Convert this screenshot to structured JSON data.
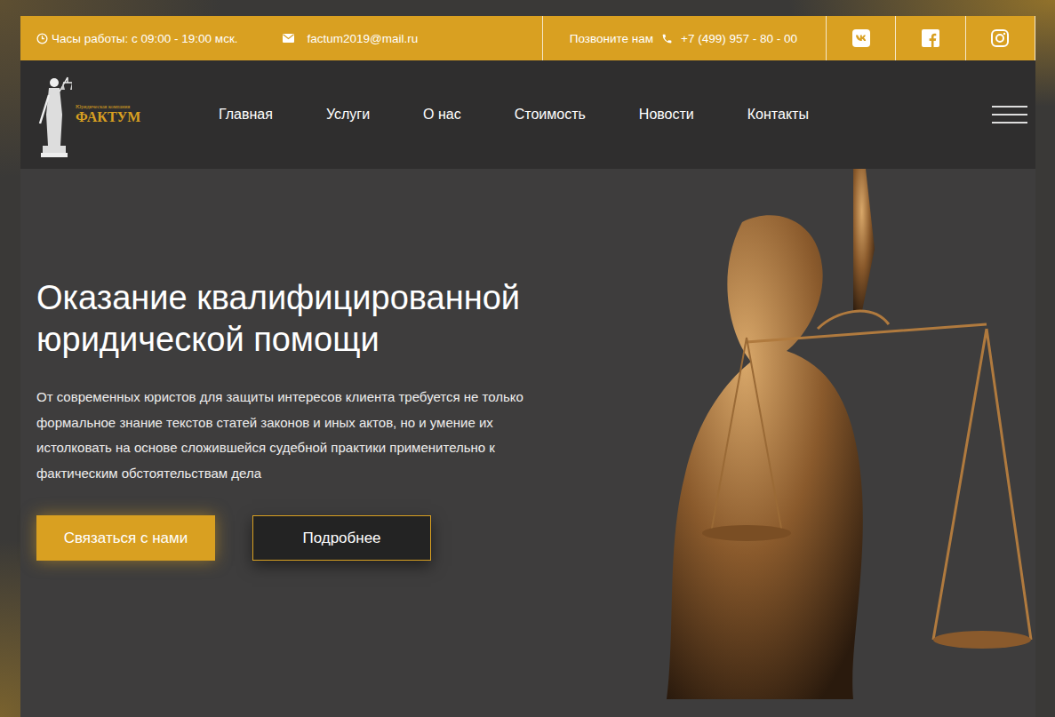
{
  "topbar": {
    "hours": "Часы работы: с 09:00 - 19:00 мск.",
    "email": "factum2019@mail.ru",
    "call_label": "Позвоните нам",
    "phone": "+7 (499) 957 - 80 - 00"
  },
  "logo": {
    "tagline": "Юридическая компания",
    "name": "ФАКТУМ"
  },
  "nav": [
    {
      "label": "Главная",
      "selected": false
    },
    {
      "label": "Услуги",
      "selected": false
    },
    {
      "label": "О нас",
      "selected": false
    },
    {
      "label": "Стоимость",
      "selected": false
    },
    {
      "label": "Новости",
      "selected": false
    },
    {
      "label": "Контакты",
      "selected": false
    }
  ],
  "hero": {
    "title": [
      "Оказание квалифицированной",
      "юридической помощи"
    ],
    "text": "От современных юристов для защиты интересов клиента требуется не только формальное знание текстов статей законов и иных актов, но и умение их истолковать на основе сложившейся судебной практики применительно к фактическим обстоятельствам дела",
    "buttons": [
      {
        "label": "Связаться с нами",
        "kind": "primary"
      },
      {
        "label": "Подробнее",
        "kind": "outline"
      }
    ]
  }
}
